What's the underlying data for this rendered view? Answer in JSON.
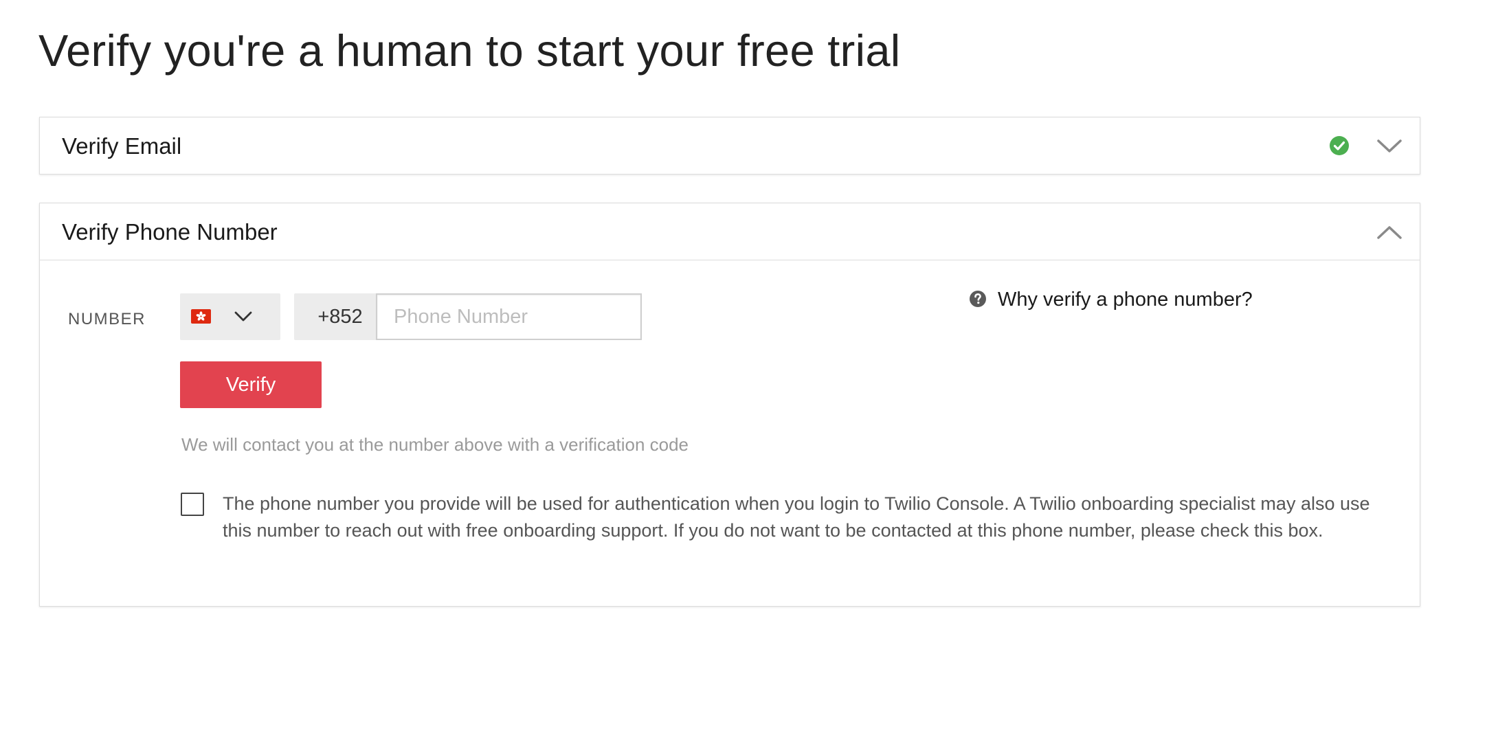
{
  "page": {
    "title": "Verify you're a human to start your free trial"
  },
  "email_section": {
    "title": "Verify Email",
    "status_icon": "check-circle-icon",
    "status_color": "#4caf50",
    "toggle_icon": "chevron-down-icon"
  },
  "phone_section": {
    "title": "Verify Phone Number",
    "toggle_icon": "chevron-up-icon",
    "number_label": "NUMBER",
    "country": {
      "flag_icon": "hong-kong-flag-icon",
      "dial_code": "+852"
    },
    "phone_input": {
      "value": "",
      "placeholder": "Phone Number"
    },
    "verify_label": "Verify",
    "helper_text": "We will contact you at the number above with a verification code",
    "consent": {
      "checked": false,
      "text": "The phone number you provide will be used for authentication when you login to Twilio Console. A Twilio onboarding specialist may also use this number to reach out with free onboarding support. If you do not want to be contacted at this phone number, please check this box."
    },
    "why_link": {
      "icon": "help-circle-icon",
      "label": "Why verify a phone number?"
    }
  },
  "colors": {
    "accent_red": "#e2434f",
    "success_green": "#4caf50",
    "flag_red": "#de2910"
  }
}
